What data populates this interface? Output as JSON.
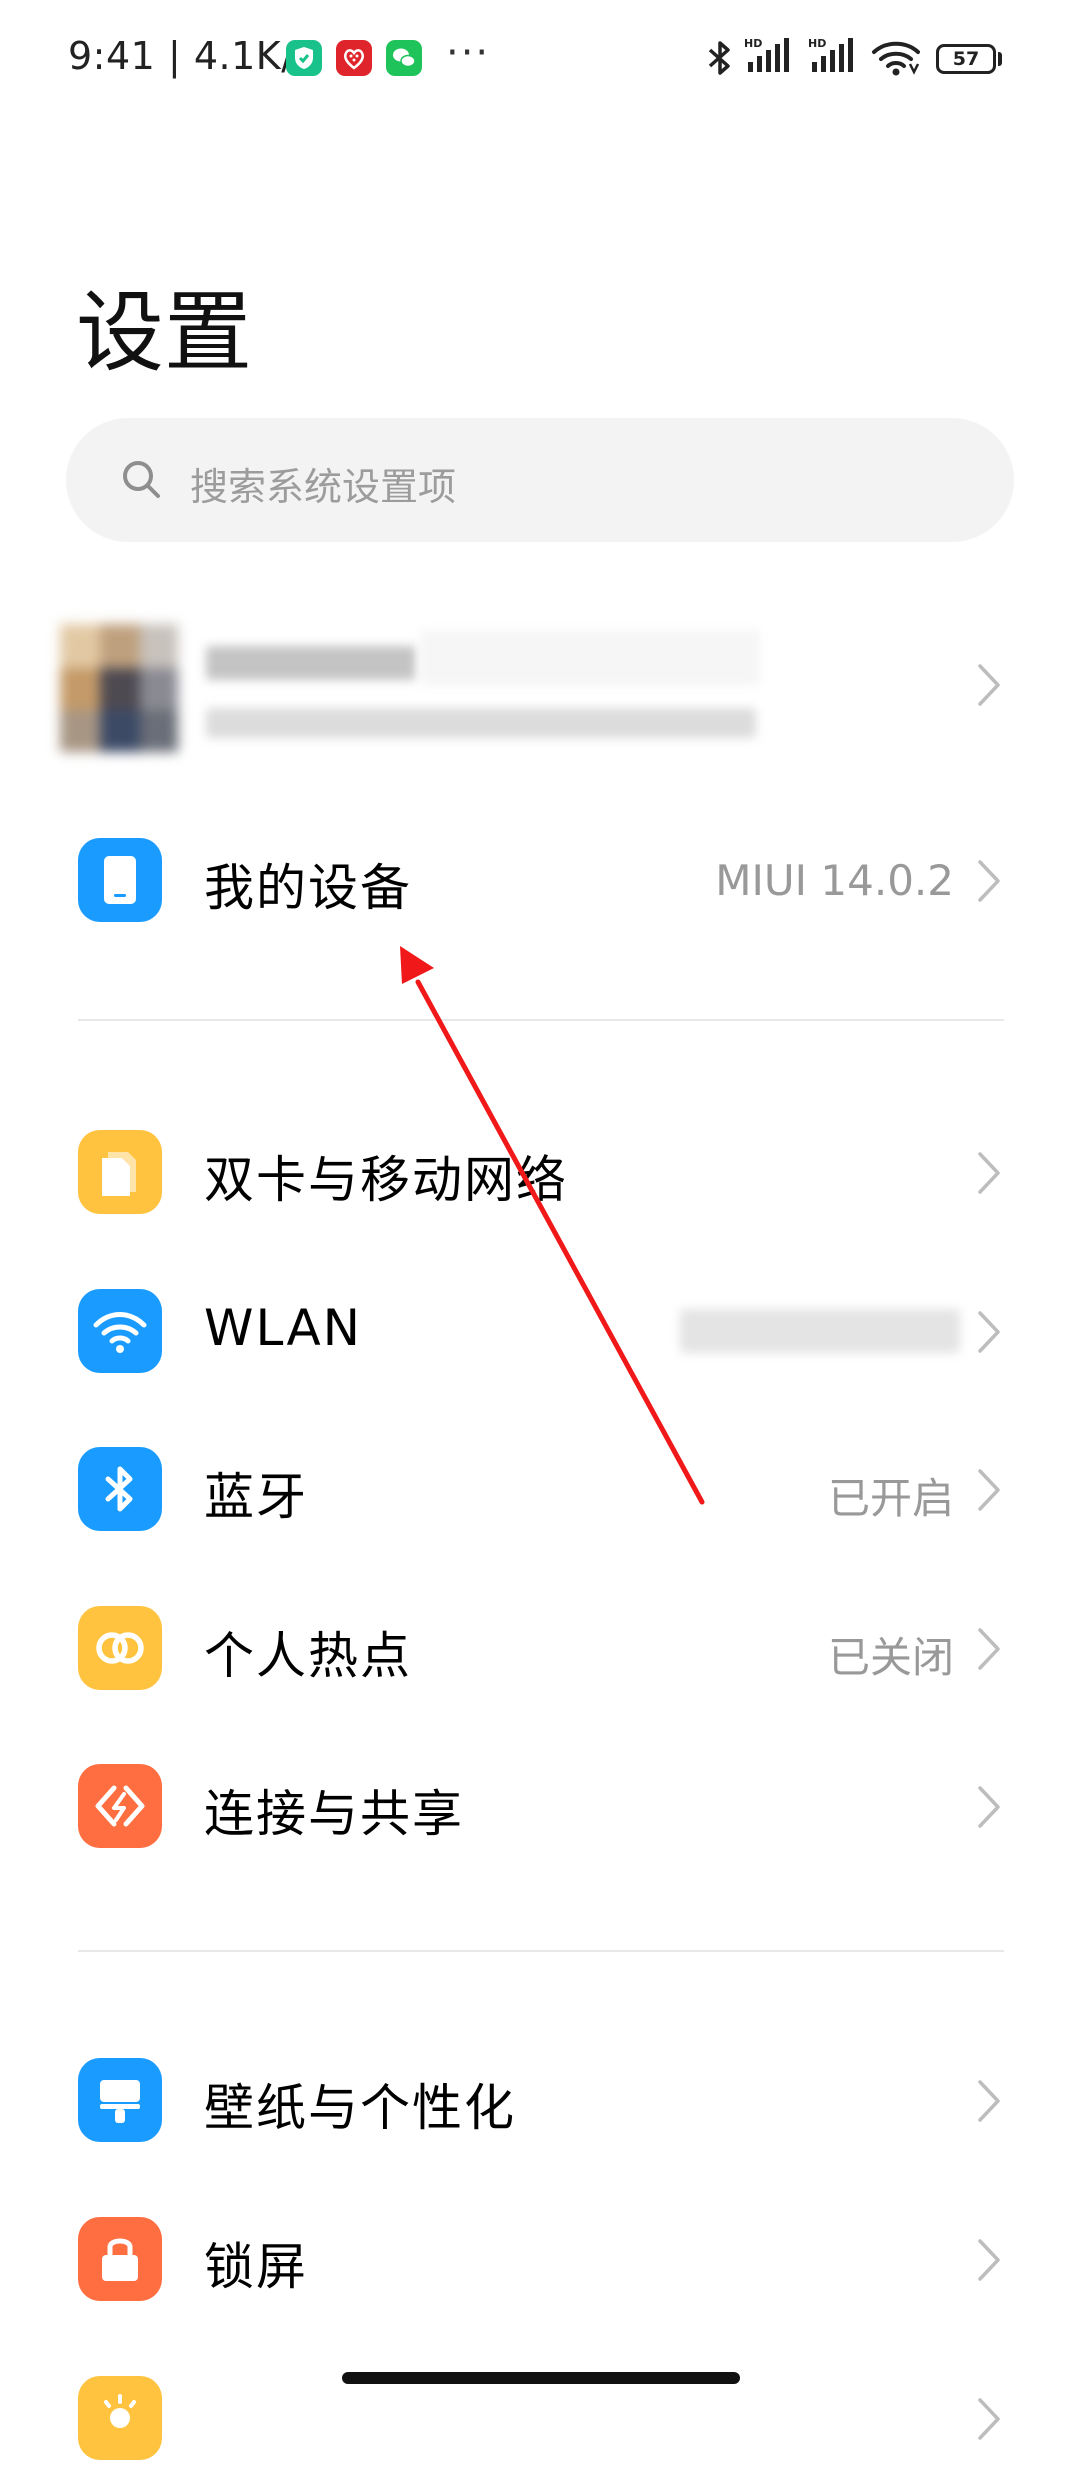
{
  "status_bar": {
    "time": "9:41",
    "separator": "|",
    "net_speed": "4.1K/s",
    "more": "···",
    "battery_level": "57",
    "status_app_icons": [
      "shield-app-icon",
      "red-app-icon",
      "wechat-icon"
    ]
  },
  "header": {
    "title": "设置"
  },
  "search": {
    "placeholder": "搜索系统设置项"
  },
  "rows": {
    "my_device": {
      "label": "我的设备",
      "value": "MIUI 14.0.2",
      "icon": "phone-icon",
      "color": "#1a9bff"
    },
    "dual_sim": {
      "label": "双卡与移动网络",
      "icon": "sim-card-icon",
      "color": "#ffc340"
    },
    "wlan": {
      "label": "WLAN",
      "icon": "wifi-icon",
      "color": "#1a9bff"
    },
    "bluetooth": {
      "label": "蓝牙",
      "value": "已开启",
      "icon": "bluetooth-icon",
      "color": "#1a9bff"
    },
    "hotspot": {
      "label": "个人热点",
      "value": "已关闭",
      "icon": "hotspot-icon",
      "color": "#ffc340"
    },
    "connect_share": {
      "label": "连接与共享",
      "icon": "share-icon",
      "color": "#ff6e40"
    },
    "wallpaper": {
      "label": "壁纸与个性化",
      "icon": "brush-icon",
      "color": "#1a9bff"
    },
    "lock_screen": {
      "label": "锁屏",
      "icon": "lock-icon",
      "color": "#ff6e40"
    },
    "display": {
      "icon": "display-icon",
      "color": "#ffc340"
    }
  },
  "colors": {
    "accent_blue": "#1a9bff",
    "accent_yellow": "#ffc340",
    "accent_orange": "#ff6e40",
    "annotation_arrow": "#f01818"
  }
}
